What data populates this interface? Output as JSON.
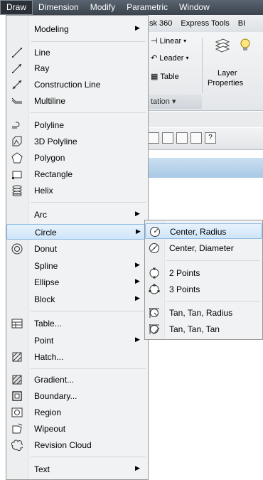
{
  "menubar": {
    "items": [
      "Draw",
      "Dimension",
      "Modify",
      "Parametric",
      "Window"
    ]
  },
  "background": {
    "ribbon_tabs": [
      "sk 360",
      "Express Tools",
      "BI"
    ],
    "annotation": {
      "linear": "Linear",
      "leader": "Leader",
      "table": "Table",
      "panel": "tation"
    },
    "layer_label_1": "Layer",
    "layer_label_2": "Properties"
  },
  "draw_menu": {
    "items": [
      {
        "label": "Modeling",
        "icon": "none",
        "arrow": true
      },
      {
        "label": "Line",
        "icon": "line-icon"
      },
      {
        "label": "Ray",
        "icon": "ray-icon"
      },
      {
        "label": "Construction Line",
        "icon": "construction-line-icon"
      },
      {
        "label": "Multiline",
        "icon": "multiline-icon"
      },
      {
        "label": "Polyline",
        "icon": "polyline-icon"
      },
      {
        "label": "3D Polyline",
        "icon": "3d-polyline-icon"
      },
      {
        "label": "Polygon",
        "icon": "polygon-icon"
      },
      {
        "label": "Rectangle",
        "icon": "rectangle-icon"
      },
      {
        "label": "Helix",
        "icon": "helix-icon"
      },
      {
        "label": "Arc",
        "icon": "none",
        "arrow": true
      },
      {
        "label": "Circle",
        "icon": "none",
        "arrow": true,
        "highlighted": true
      },
      {
        "label": "Donut",
        "icon": "donut-icon"
      },
      {
        "label": "Spline",
        "icon": "none",
        "arrow": true
      },
      {
        "label": "Ellipse",
        "icon": "none",
        "arrow": true
      },
      {
        "label": "Block",
        "icon": "none",
        "arrow": true
      },
      {
        "label": "Table...",
        "icon": "table-icon"
      },
      {
        "label": "Point",
        "icon": "none",
        "arrow": true
      },
      {
        "label": "Hatch...",
        "icon": "hatch-icon"
      },
      {
        "label": "Gradient...",
        "icon": "gradient-icon"
      },
      {
        "label": "Boundary...",
        "icon": "boundary-icon"
      },
      {
        "label": "Region",
        "icon": "region-icon"
      },
      {
        "label": "Wipeout",
        "icon": "wipeout-icon"
      },
      {
        "label": "Revision Cloud",
        "icon": "revision-cloud-icon"
      },
      {
        "label": "Text",
        "icon": "none",
        "arrow": true
      }
    ]
  },
  "circle_submenu": {
    "items": [
      {
        "label": "Center, Radius",
        "icon": "circle-center-radius-icon",
        "highlighted": true
      },
      {
        "label": "Center, Diameter",
        "icon": "circle-center-diameter-icon"
      },
      {
        "label": "2 Points",
        "icon": "circle-2-points-icon"
      },
      {
        "label": "3 Points",
        "icon": "circle-3-points-icon"
      },
      {
        "label": "Tan, Tan, Radius",
        "icon": "circle-tan-tan-radius-icon"
      },
      {
        "label": "Tan, Tan, Tan",
        "icon": "circle-tan-tan-tan-icon"
      }
    ]
  },
  "colors": {
    "menubar": "#3a434d",
    "highlight": "#cfe5f9",
    "highlight_border": "#8fbce3",
    "menu_bg": "#f1f2f3"
  }
}
